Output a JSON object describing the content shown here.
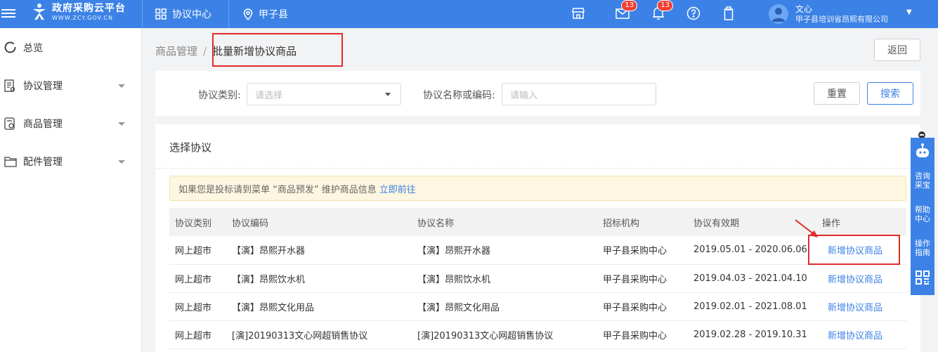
{
  "header": {
    "logo_title": "政府采购云平台",
    "logo_sub": "WWW.ZCY.GOV.CN",
    "nav_center_label": "协议中心",
    "nav_region_label": "甲子县",
    "mail_badge": "13",
    "bell_badge": "13",
    "user_name": "文心",
    "user_org": "甲子县培训省昂熙有限公司",
    "icons": [
      "menu-icon",
      "store-icon",
      "mail-icon",
      "bell-icon",
      "help-icon",
      "clipboard-icon"
    ]
  },
  "sidebar": {
    "items": [
      {
        "label": "总览",
        "icon": "dashboard-icon"
      },
      {
        "label": "协议管理",
        "icon": "document-icon"
      },
      {
        "label": "商品管理",
        "icon": "goods-icon"
      },
      {
        "label": "配件管理",
        "icon": "folder-icon"
      }
    ]
  },
  "breadcrumb": {
    "parent": "商品管理",
    "separator": "/",
    "current": "批量新增协议商品"
  },
  "actions": {
    "back_label": "返回"
  },
  "filter": {
    "type_label": "协议类别:",
    "type_placeholder": "请选择",
    "name_label": "协议名称或编码:",
    "name_placeholder": "请输入",
    "reset_label": "重置",
    "search_label": "搜索"
  },
  "section": {
    "title": "选择协议"
  },
  "notice": {
    "text": "如果您是投标请到菜单 “商品预发” 维护商品信息",
    "link": "立即前往"
  },
  "table": {
    "headers": [
      "协议类别",
      "协议编码",
      "协议名称",
      "招标机构",
      "协议有效期",
      "操作"
    ],
    "rows": [
      [
        "网上超市",
        "【演】昂熙开水器",
        "【演】昂熙开水器",
        "甲子县采购中心",
        "2019.05.01 - 2020.06.06",
        "新增协议商品"
      ],
      [
        "网上超市",
        "【演】昂熙饮水机",
        "【演】昂熙饮水机",
        "甲子县采购中心",
        "2019.04.03 - 2021.04.10",
        "新增协议商品"
      ],
      [
        "网上超市",
        "【演】昂熙文化用品",
        "【演】昂熙文化用品",
        "甲子县采购中心",
        "2019.02.01 - 2021.08.01",
        "新增协议商品"
      ],
      [
        "网上超市",
        "[演]20190313文心网超销售协议",
        "[演]20190313文心网超销售协议",
        "甲子县采购中心",
        "2019.02.28 - 2019.10.31",
        "新增协议商品"
      ]
    ]
  },
  "float_bar": {
    "items": [
      "咨询",
      "采宝",
      "帮助",
      "中心",
      "操作",
      "指南"
    ]
  },
  "colors": {
    "primary": "#3c82e6",
    "highlight": "#e02b2b",
    "notice_bg": "#fdf6e0"
  }
}
